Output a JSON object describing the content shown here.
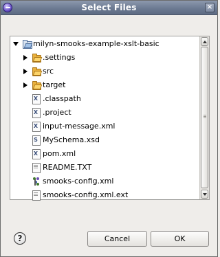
{
  "dialog": {
    "title": "Select Files"
  },
  "tree": {
    "root": {
      "label": "milyn-smooks-example-xslt-basic",
      "expanded": true,
      "icon": "project-folder-icon"
    },
    "items": [
      {
        "label": ".settings",
        "icon": "folder-icon",
        "expandable": true
      },
      {
        "label": "src",
        "icon": "folder-icon",
        "expandable": true
      },
      {
        "label": "target",
        "icon": "folder-icon",
        "expandable": true
      },
      {
        "label": ".classpath",
        "icon": "xml-file-icon",
        "glyph": "X"
      },
      {
        "label": ".project",
        "icon": "xml-file-icon",
        "glyph": "X"
      },
      {
        "label": "input-message.xml",
        "icon": "xml-file-icon",
        "glyph": "X"
      },
      {
        "label": "MySchema.xsd",
        "icon": "xsd-file-icon",
        "glyph": "S"
      },
      {
        "label": "pom.xml",
        "icon": "xml-file-icon",
        "glyph": "X"
      },
      {
        "label": "README.TXT",
        "icon": "text-file-icon"
      },
      {
        "label": "smooks-config.xml",
        "icon": "smooks-config-icon"
      },
      {
        "label": "smooks-config.xml.ext",
        "icon": "text-file-icon"
      }
    ]
  },
  "buttons": {
    "help": "?",
    "cancel": "Cancel",
    "ok": "OK"
  },
  "titlebar": {
    "close": "×"
  }
}
